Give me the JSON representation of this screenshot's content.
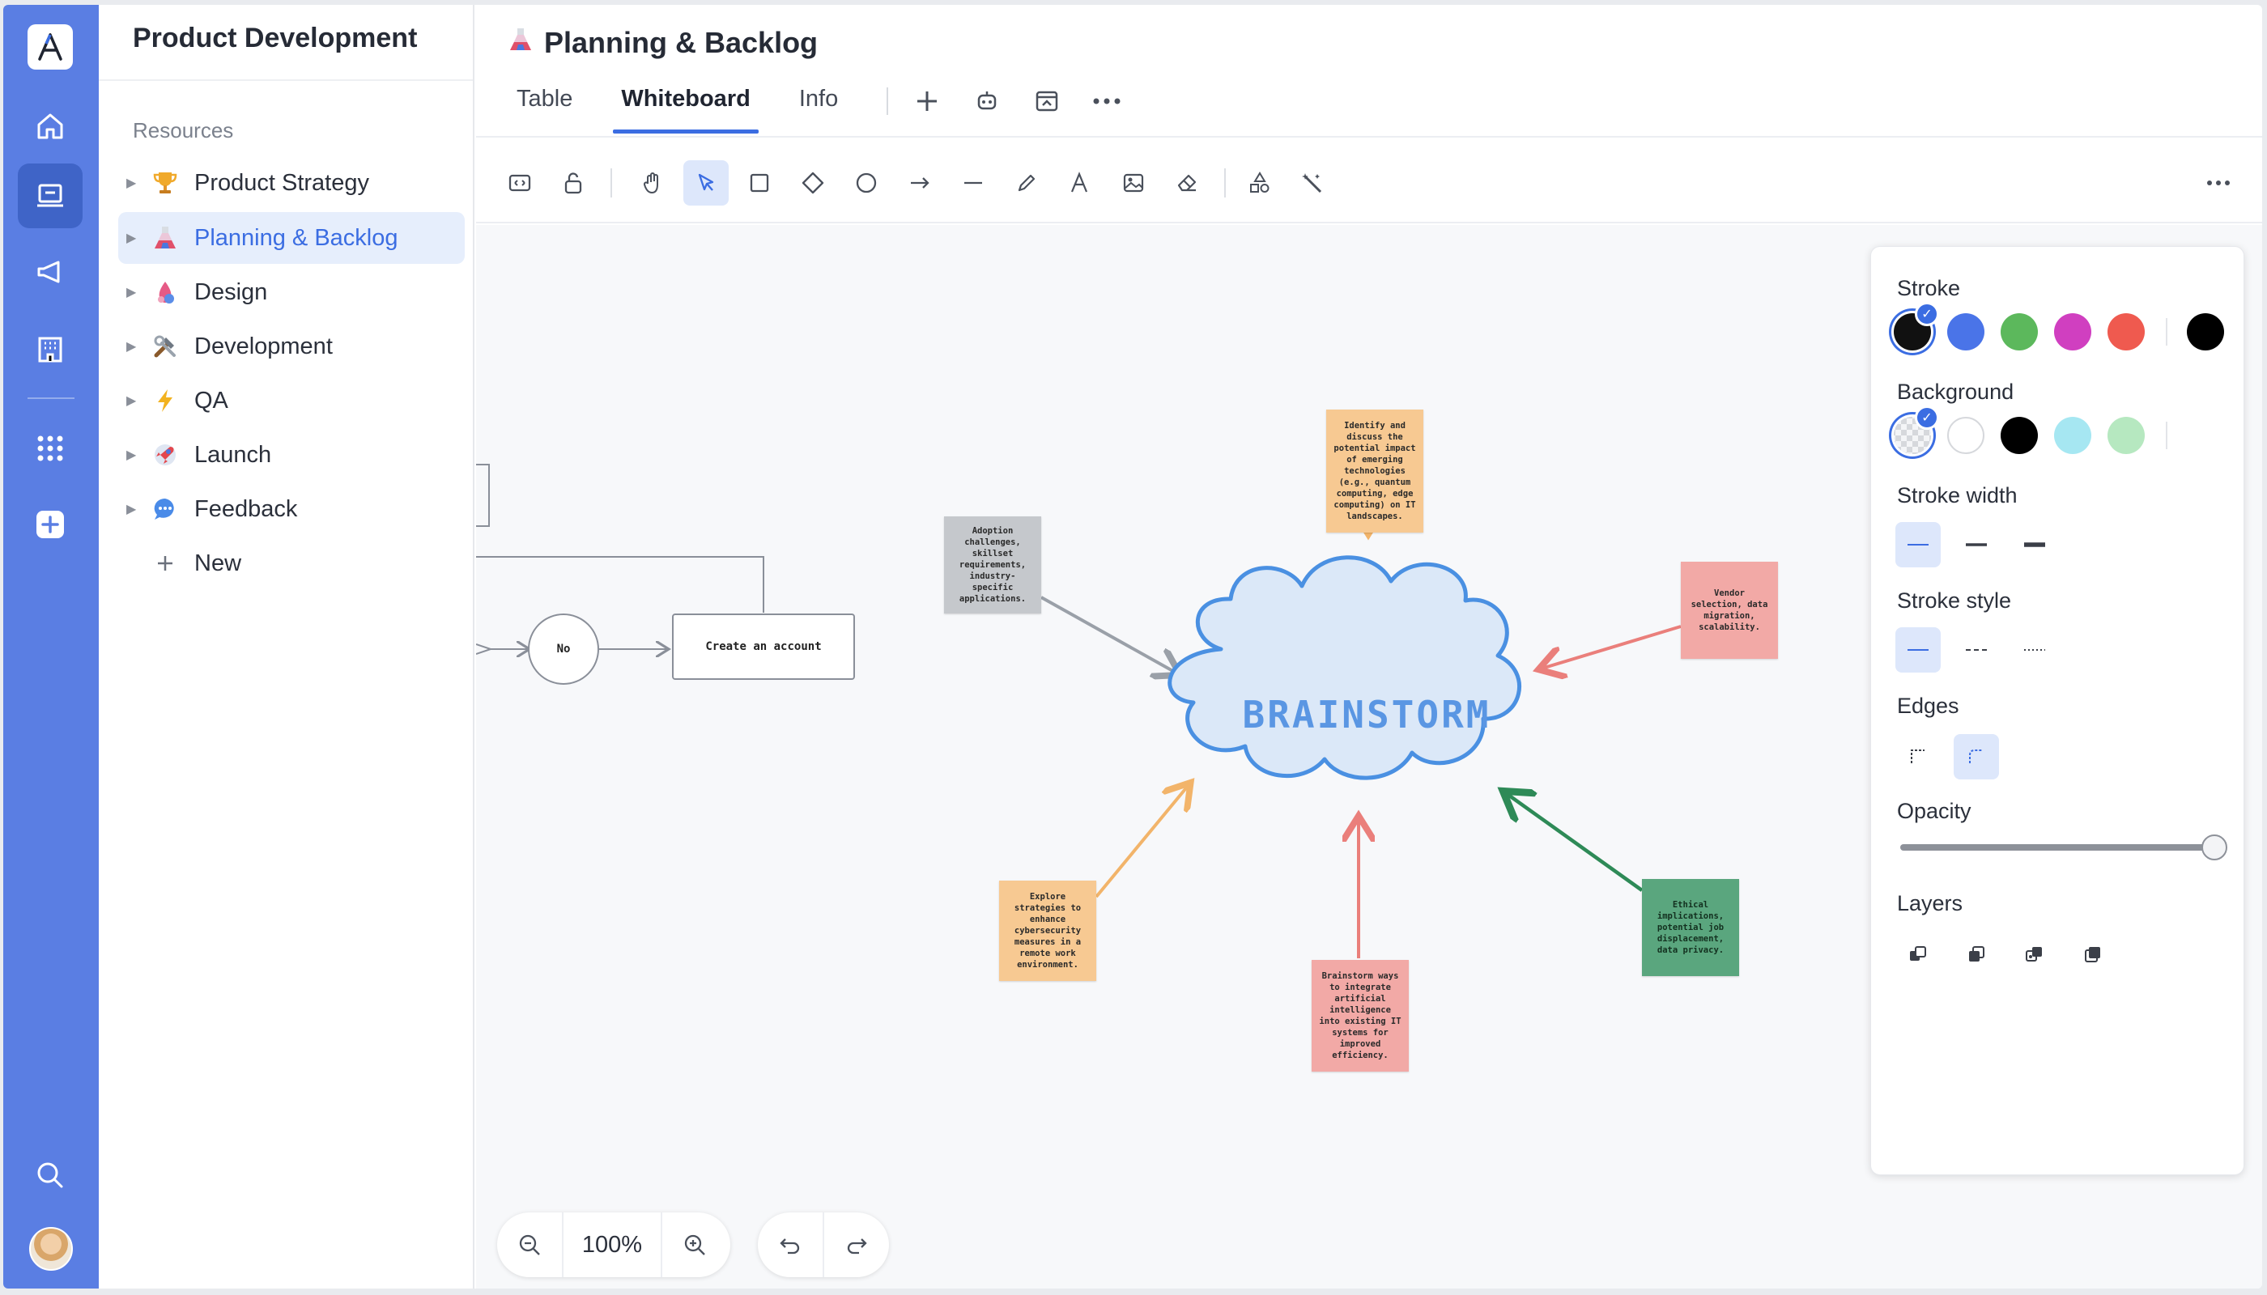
{
  "sidebar": {
    "title": "Product Development",
    "section_label": "Resources",
    "items": [
      {
        "label": "Product Strategy",
        "icon": "trophy-icon"
      },
      {
        "label": "Planning & Backlog",
        "icon": "flask-icon",
        "active": true
      },
      {
        "label": "Design",
        "icon": "paint-drop-icon"
      },
      {
        "label": "Development",
        "icon": "tools-icon"
      },
      {
        "label": "QA",
        "icon": "lightning-icon"
      },
      {
        "label": "Launch",
        "icon": "rocket-icon"
      },
      {
        "label": "Feedback",
        "icon": "speech-bubble-icon"
      }
    ],
    "new_label": "New"
  },
  "header": {
    "title": "Planning & Backlog",
    "tabs": [
      "Table",
      "Whiteboard",
      "Info"
    ],
    "active_tab": "Whiteboard"
  },
  "canvas": {
    "central": "BRAINSTORM",
    "notes": [
      "Identify and discuss the potential impact of emerging technologies (e.g., quantum computing, edge computing) on IT landscapes.",
      "Adoption challenges, skillset requirements, industry-specific applications.",
      "Vendor selection, data migration, scalability.",
      "Explore strategies to enhance cybersecurity measures in a remote work environment.",
      "Brainstorm ways to integrate artificial intelligence into existing IT systems for improved efficiency.",
      "Ethical implications, potential job displacement, data privacy."
    ],
    "flow": {
      "circle": "No",
      "box": "Create an account"
    }
  },
  "panel": {
    "stroke_label": "Stroke",
    "stroke_colors": [
      "#111111",
      "#4a74e8",
      "#5cb85c",
      "#d03fc0",
      "#ef5a4f",
      "#000000"
    ],
    "background_label": "Background",
    "background_colors": [
      "transparent",
      "#ffffff",
      "#000000",
      "#a6e7f2",
      "#b6e8c0"
    ],
    "stroke_width_label": "Stroke width",
    "stroke_style_label": "Stroke style",
    "edges_label": "Edges",
    "opacity_label": "Opacity",
    "opacity_value": 1.0,
    "layers_label": "Layers"
  },
  "zoom": {
    "value": "100%"
  },
  "colors": {
    "rail": "#5a7ee3",
    "accent": "#3b6de2",
    "cloud_fill": "#dbe8f8",
    "cloud_stroke": "#4a90e2",
    "note_orange": "#f7c992",
    "note_gray": "#c5c8cc",
    "note_red": "#f2a9a6",
    "note_green": "#5aa67e"
  }
}
